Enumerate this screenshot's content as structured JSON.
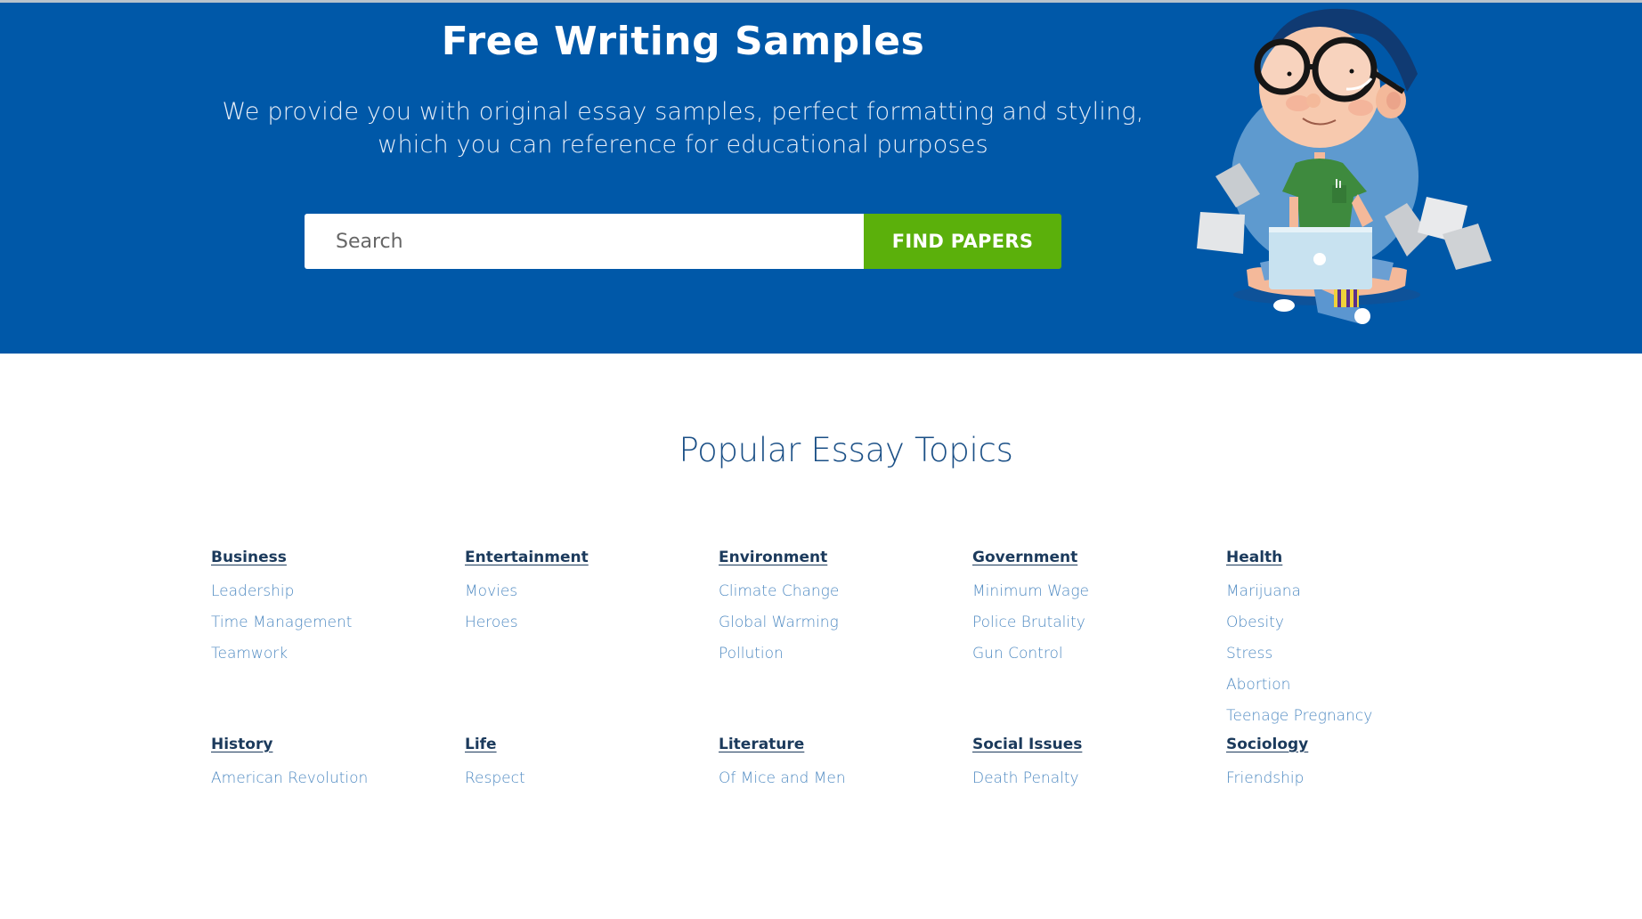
{
  "hero": {
    "title": "Free Writing Samples",
    "subtitle_lines": [
      "We provide you with original essay samples, perfect formatting and styling,",
      "which you can reference for educational purposes"
    ],
    "search": {
      "placeholder": "Search",
      "value": "",
      "button_label": "FIND PAPERS"
    },
    "illustration": "student-with-laptop-illustration"
  },
  "colors": {
    "hero_background": "#0058a8",
    "button_green": "#5bb00b",
    "heading_dark": "#1b3a5c",
    "link_blue": "#4f8ac2",
    "section_title": "#1a4f86"
  },
  "topics": {
    "title": "Popular Essay Topics",
    "rows": [
      [
        {
          "category": "Business",
          "items": [
            "Leadership",
            "Time Management",
            "Teamwork"
          ]
        },
        {
          "category": "Entertainment",
          "items": [
            "Movies",
            "Heroes"
          ]
        },
        {
          "category": "Environment",
          "items": [
            "Climate Change",
            "Global Warming",
            "Pollution"
          ]
        },
        {
          "category": "Government",
          "items": [
            "Minimum Wage",
            "Police Brutality",
            "Gun Control"
          ]
        },
        {
          "category": "Health",
          "items": [
            "Marijuana",
            "Obesity",
            "Stress",
            "Abortion",
            "Teenage Pregnancy"
          ]
        }
      ],
      [
        {
          "category": "History",
          "items": [
            "American Revolution"
          ]
        },
        {
          "category": "Life",
          "items": [
            "Respect"
          ]
        },
        {
          "category": "Literature",
          "items": [
            "Of Mice and Men"
          ]
        },
        {
          "category": "Social Issues",
          "items": [
            "Death Penalty"
          ]
        },
        {
          "category": "Sociology",
          "items": [
            "Friendship"
          ]
        }
      ]
    ]
  }
}
